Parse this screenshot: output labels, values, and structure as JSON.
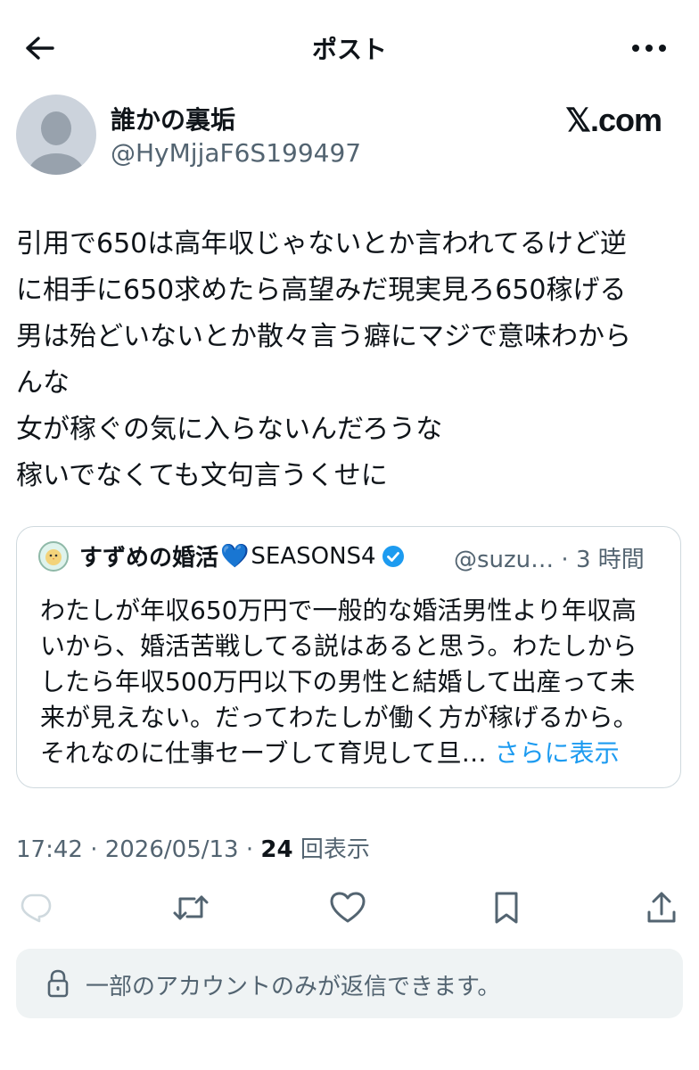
{
  "header": {
    "title": "ポスト"
  },
  "author": {
    "display_name": "誰かの裏垢",
    "handle": "@HyMjjaF6S199497"
  },
  "brand": {
    "logo_text": "𝕏.com"
  },
  "post": {
    "lines": [
      "引用で650は高年収じゃないとか言われてるけど逆",
      "に相手に650求めたら高望みだ現実見ろ650稼げる",
      "男は殆どいないとか散々言う癖にマジで意味わから",
      "んな",
      "女が稼ぐの気に入らないんだろうな",
      "稼いでなくても文句言うくせに"
    ]
  },
  "quote": {
    "name_main": "すずめの婚活",
    "name_heart": "💙",
    "name_suffix": "SEASONS4",
    "handle_time": "@suzu… · 3 時間",
    "lines": [
      "わたしが年収650万円で一般的な婚活男性より年収高",
      "いから、婚活苦戦してる説はあると思う。わたしから",
      "したら年収500万円以下の男性と結婚して出産って未",
      "来が見えない。だってわたしが働く方が稼げるから。",
      "それなのに仕事セーブして育児して旦…"
    ],
    "show_more": "さらに表示"
  },
  "meta": {
    "time_date": "17:42 · 2026/05/13 · ",
    "view_count": "24",
    "view_label": " 回表示"
  },
  "reply_restriction": {
    "text": "一部のアカウントのみが返信できます。"
  },
  "icons": [
    "back-arrow-icon",
    "more-icon",
    "verified-badge-icon",
    "reply-icon",
    "repost-icon",
    "like-icon",
    "bookmark-icon",
    "share-icon",
    "lock-icon"
  ],
  "colors": {
    "accent": "#1d9bf0",
    "secondary_text": "#536471",
    "text": "#0f1419"
  }
}
